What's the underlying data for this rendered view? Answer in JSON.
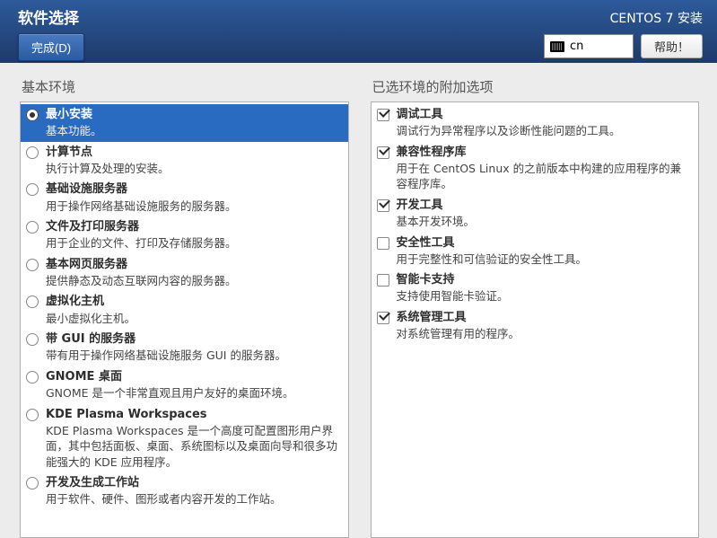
{
  "header": {
    "title": "软件选择",
    "done_label": "完成(D)",
    "install_title": "CENTOS 7 安装",
    "lang": "cn",
    "help_label": "帮助！"
  },
  "left": {
    "title": "基本环境",
    "items": [
      {
        "title": "最小安装",
        "desc": "基本功能。",
        "selected": true
      },
      {
        "title": "计算节点",
        "desc": "执行计算及处理的安装。",
        "selected": false
      },
      {
        "title": "基础设施服务器",
        "desc": "用于操作网络基础设施服务的服务器。",
        "selected": false
      },
      {
        "title": "文件及打印服务器",
        "desc": "用于企业的文件、打印及存储服务器。",
        "selected": false
      },
      {
        "title": "基本网页服务器",
        "desc": "提供静态及动态互联网内容的服务器。",
        "selected": false
      },
      {
        "title": "虚拟化主机",
        "desc": "最小虚拟化主机。",
        "selected": false
      },
      {
        "title": "带 GUI 的服务器",
        "desc": "带有用于操作网络基础设施服务 GUI 的服务器。",
        "selected": false
      },
      {
        "title": "GNOME 桌面",
        "desc": "GNOME 是一个非常直观且用户友好的桌面环境。",
        "selected": false
      },
      {
        "title": "KDE Plasma Workspaces",
        "desc": "KDE Plasma Workspaces 是一个高度可配置图形用户界面，其中包括面板、桌面、系统图标以及桌面向导和很多功能强大的 KDE 应用程序。",
        "selected": false
      },
      {
        "title": "开发及生成工作站",
        "desc": "用于软件、硬件、图形或者内容开发的工作站。",
        "selected": false
      }
    ]
  },
  "right": {
    "title": "已选环境的附加选项",
    "items": [
      {
        "title": "调试工具",
        "desc": "调试行为异常程序以及诊断性能问题的工具。",
        "checked": true
      },
      {
        "title": "兼容性程序库",
        "desc": "用于在 CentOS Linux 的之前版本中构建的应用程序的兼容程序库。",
        "checked": true
      },
      {
        "title": "开发工具",
        "desc": "基本开发环境。",
        "checked": true
      },
      {
        "title": "安全性工具",
        "desc": "用于完整性和可信验证的安全性工具。",
        "checked": false
      },
      {
        "title": "智能卡支持",
        "desc": "支持使用智能卡验证。",
        "checked": false
      },
      {
        "title": "系统管理工具",
        "desc": "对系统管理有用的程序。",
        "checked": true
      }
    ]
  }
}
